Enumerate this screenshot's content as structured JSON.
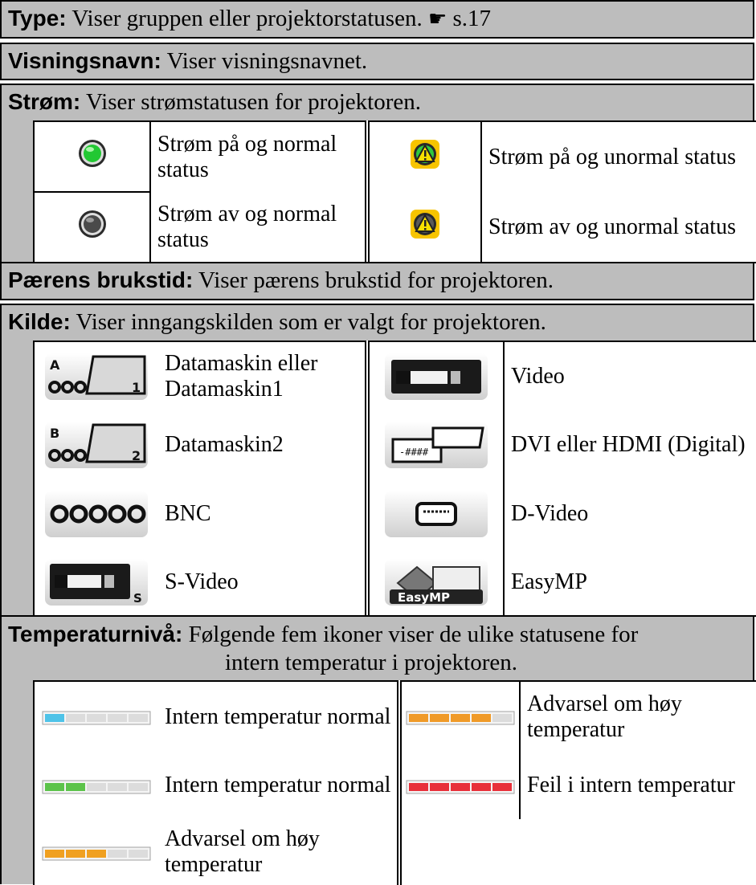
{
  "type_row": {
    "label": "Type:",
    "text": "Viser gruppen eller projektorstatusen.",
    "hand": "☛",
    "ref": "s.17"
  },
  "name_row": {
    "label": "Visningsnavn:",
    "text": "Viser visningsnavnet."
  },
  "power_row": {
    "label": "Strøm:",
    "text": "Viser strømstatusen for projektoren."
  },
  "power_items": [
    {
      "icon": "power-on-normal-icon",
      "color": "#22c833",
      "text": "Strøm på og normal status"
    },
    {
      "icon": "power-on-abnormal-icon",
      "color": "#f7c400",
      "text": "Strøm på og unormal status"
    },
    {
      "icon": "power-off-normal-icon",
      "color": "#4a4a4a",
      "text": "Strøm av og normal status"
    },
    {
      "icon": "power-off-abnormal-icon",
      "color": "#f7c400",
      "text": "Strøm av og unormal status"
    }
  ],
  "lamp_row": {
    "label": "Pærens brukstid:",
    "text": "Viser pærens brukstid for projektoren."
  },
  "source_row": {
    "label": "Kilde:",
    "text": "Viser inngangskilden som er valgt for projektoren."
  },
  "source_items": [
    {
      "icon": "computer1-icon",
      "text": "Datamaskin eller Datamaskin1",
      "letter": "A",
      "num": "1"
    },
    {
      "icon": "video-icon",
      "text": "Video"
    },
    {
      "icon": "computer2-icon",
      "text": "Datamaskin2",
      "letter": "B",
      "num": "2"
    },
    {
      "icon": "dvi-hdmi-icon",
      "text": "DVI eller HDMI (Digital)"
    },
    {
      "icon": "bnc-icon",
      "text": "BNC"
    },
    {
      "icon": "d-video-icon",
      "text": "D-Video"
    },
    {
      "icon": "s-video-icon",
      "text": "S-Video",
      "badge": "S"
    },
    {
      "icon": "easymp-icon",
      "text": "EasyMP",
      "badge": "EasyMP"
    }
  ],
  "temp_row": {
    "label": "Temperaturnivå:",
    "text": "Følgende fem ikoner viser de ulike statusene for",
    "text2": "intern temperatur i projektoren."
  },
  "temp_items": [
    {
      "icon": "temp-level-1-icon",
      "color": "#4fc3e8",
      "filled": 1,
      "text": "Intern temperatur normal"
    },
    {
      "icon": "temp-level-4-icon",
      "color": "#f09a28",
      "filled": 4,
      "text": "Advarsel om høy temperatur"
    },
    {
      "icon": "temp-level-2-icon",
      "color": "#5cc34a",
      "filled": 2,
      "text": "Intern temperatur normal"
    },
    {
      "icon": "temp-level-5-icon",
      "color": "#e8303a",
      "filled": 5,
      "text": "Feil i intern temperatur"
    },
    {
      "icon": "temp-level-3-icon",
      "color": "#f0a020",
      "filled": 3,
      "text": "Advarsel om høy temperatur"
    }
  ]
}
